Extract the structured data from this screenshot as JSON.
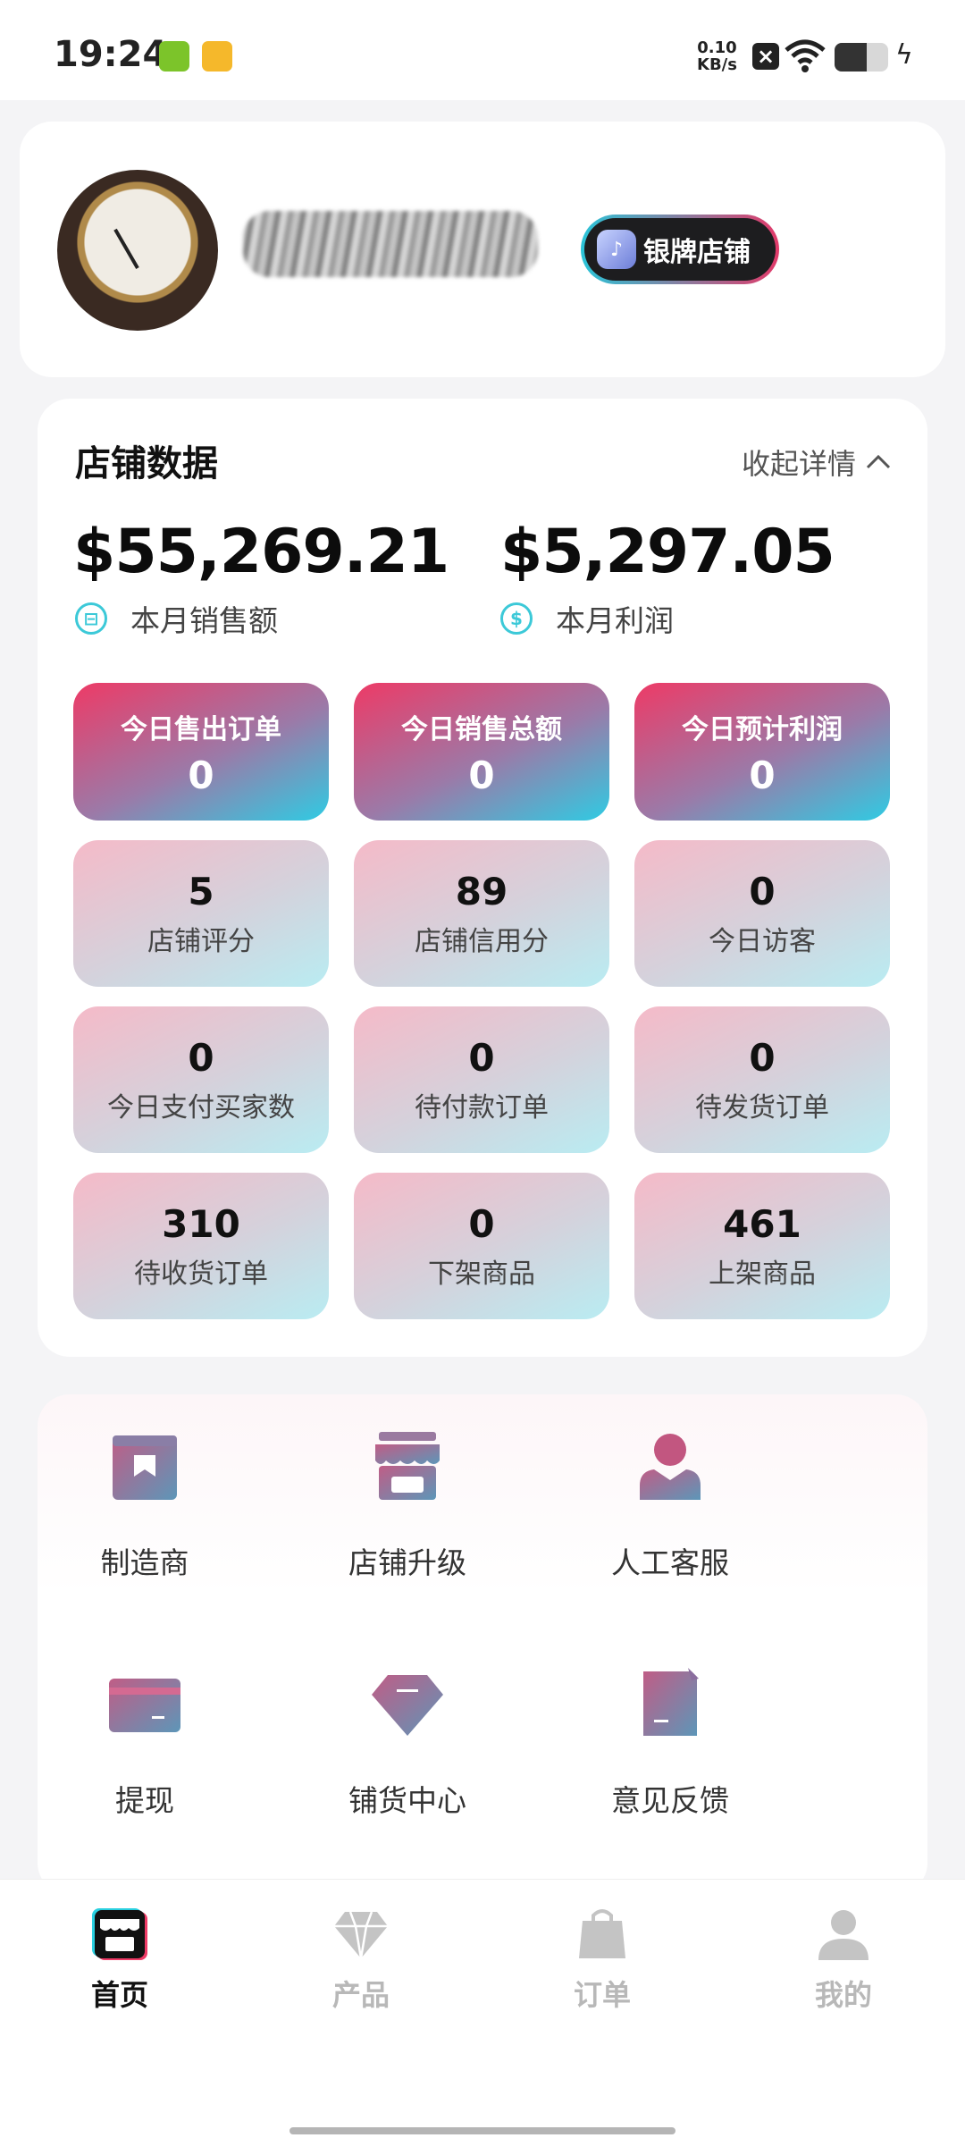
{
  "status_bar": {
    "time": "19:24",
    "net_speed_value": "0.10",
    "net_speed_unit": "KB/s",
    "icons": [
      "usb-icon",
      "tools-icon",
      "no-sim-icon",
      "wifi-icon",
      "battery-icon",
      "charging-icon"
    ]
  },
  "profile": {
    "badge_label": "银牌店铺"
  },
  "store_data": {
    "title": "店铺数据",
    "collapse_label": "收起详情",
    "monthly_sales_amount": "$55,269.21",
    "monthly_sales_label": "本月销售额",
    "monthly_profit_amount": "$5,297.05",
    "monthly_profit_label": "本月利润",
    "highlight_tiles": [
      {
        "label": "今日售出订单",
        "value": "0"
      },
      {
        "label": "今日销售总额",
        "value": "0"
      },
      {
        "label": "今日预计利润",
        "value": "0"
      }
    ],
    "stat_tiles": [
      {
        "label": "店铺评分",
        "value": "5"
      },
      {
        "label": "店铺信用分",
        "value": "89"
      },
      {
        "label": "今日访客",
        "value": "0"
      },
      {
        "label": "今日支付买家数",
        "value": "0"
      },
      {
        "label": "待付款订单",
        "value": "0"
      },
      {
        "label": "待发货订单",
        "value": "0"
      },
      {
        "label": "待收货订单",
        "value": "310"
      },
      {
        "label": "下架商品",
        "value": "0"
      },
      {
        "label": "上架商品",
        "value": "461"
      }
    ]
  },
  "shortcuts": [
    {
      "label": "制造商",
      "icon": "box-bookmark-icon"
    },
    {
      "label": "店铺升级",
      "icon": "storefront-icon"
    },
    {
      "label": "人工客服",
      "icon": "person-icon"
    },
    {
      "label": "提现",
      "icon": "card-icon"
    },
    {
      "label": "铺货中心",
      "icon": "diamond-icon"
    },
    {
      "label": "意见反馈",
      "icon": "note-icon"
    }
  ],
  "bottom_nav": [
    {
      "label": "首页",
      "icon": "store-icon",
      "active": true
    },
    {
      "label": "产品",
      "icon": "diamond-icon",
      "active": false
    },
    {
      "label": "订单",
      "icon": "bag-icon",
      "active": false
    },
    {
      "label": "我的",
      "icon": "user-icon",
      "active": false
    }
  ],
  "colors": {
    "accent_pink": "#ee3a66",
    "accent_cyan": "#2fcbe3",
    "icon_gradient_start": "#c05d86",
    "icon_gradient_end": "#5d96b8"
  }
}
